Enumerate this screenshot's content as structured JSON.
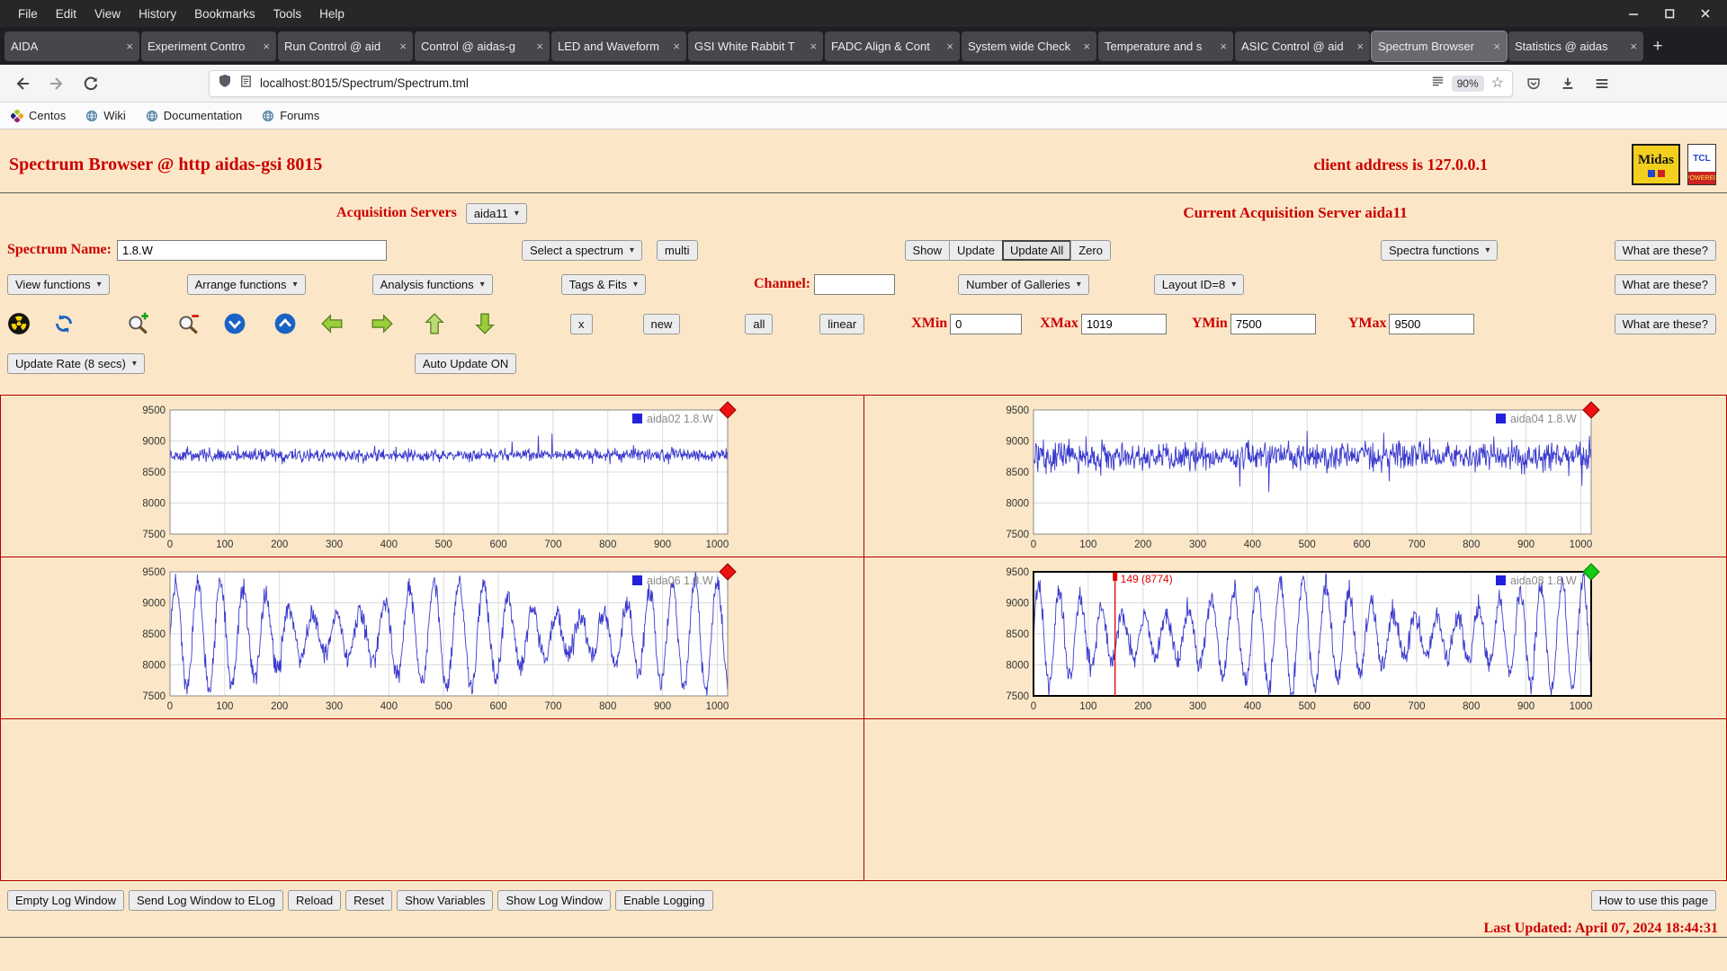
{
  "theme": {
    "accent_red": "#cc0000",
    "page_bg": "#fbe7c7",
    "gallery_border": "#b00000",
    "chart_line": "#3a3ace"
  },
  "browser": {
    "menubar": [
      "File",
      "Edit",
      "View",
      "History",
      "Bookmarks",
      "Tools",
      "Help"
    ],
    "tabs": [
      {
        "label": "AIDA",
        "active": false
      },
      {
        "label": "Experiment Contro",
        "active": false
      },
      {
        "label": "Run Control @ aid",
        "active": false
      },
      {
        "label": "Control @ aidas-g",
        "active": false
      },
      {
        "label": "LED and Waveform",
        "active": false
      },
      {
        "label": "GSI White Rabbit T",
        "active": false
      },
      {
        "label": "FADC Align & Cont",
        "active": false
      },
      {
        "label": "System wide Check",
        "active": false
      },
      {
        "label": "Temperature and s",
        "active": false
      },
      {
        "label": "ASIC Control @ aid",
        "active": false
      },
      {
        "label": "Spectrum Browser",
        "active": true
      },
      {
        "label": "Statistics @ aidas",
        "active": false
      }
    ],
    "new_tab_button": "+",
    "close_tab_glyph": "×",
    "urlbar": {
      "url": "localhost:8015/Spectrum/Spectrum.tml",
      "zoom": "90%",
      "star": "☆"
    },
    "bookmarks": [
      {
        "label": "Centos"
      },
      {
        "label": "Wiki"
      },
      {
        "label": "Documentation"
      },
      {
        "label": "Forums"
      }
    ]
  },
  "page": {
    "title": "Spectrum Browser @ http aidas-gsi 8015",
    "client_address": "client address is 127.0.0.1",
    "midas_logo": "Midas",
    "tcl_logo_top": "TCL",
    "tcl_logo_bottom": "POWERED",
    "acquisition_servers_label": "Acquisition Servers",
    "acquisition_server_select": "aida11",
    "current_server": "Current Acquisition Server aida11",
    "spectrum_name_label": "Spectrum Name:",
    "spectrum_name_value": "1.8.W",
    "select_spectrum": "Select a spectrum",
    "multi_button": "multi",
    "show_button": "Show",
    "update_button": "Update",
    "update_all_button": "Update All",
    "zero_button": "Zero",
    "spectra_functions": "Spectra functions",
    "what_are_these": "What are these?",
    "view_functions": "View functions",
    "arrange_functions": "Arrange functions",
    "analysis_functions": "Analysis functions",
    "tags_fits": "Tags & Fits",
    "channel_label": "Channel:",
    "channel_value": "",
    "number_of_galleries": "Number of Galleries",
    "layout_id": "Layout ID=8",
    "x_button": "x",
    "new_button": "new",
    "all_button": "all",
    "linear_button": "linear",
    "xmin_label": "XMin",
    "xmin": "0",
    "xmax_label": "XMax",
    "xmax": "1019",
    "ymin_label": "YMin",
    "ymin": "7500",
    "ymax_label": "YMax",
    "ymax": "9500",
    "update_rate": "Update Rate (8 secs)",
    "auto_update": "Auto Update ON",
    "log_buttons": [
      "Empty Log Window",
      "Send Log Window to ELog",
      "Reload",
      "Reset",
      "Show Variables",
      "Show Log Window",
      "Enable Logging"
    ],
    "help_button": "How to use this page",
    "last_updated": "Last Updated: April 07, 2024 18:44:31"
  },
  "gallery": {
    "rows": 3,
    "cols": 2,
    "populated_cells": 4
  },
  "chart_data": [
    {
      "type": "line",
      "name": "aida02",
      "legend": "aida02 1.8.W",
      "line_color": "#3a3ace",
      "legend_color": "#8a8a8a",
      "marker": "red-diamond",
      "marker_color": "#ee1111",
      "marker_stroke": "#8a0000",
      "selected": false,
      "xlim": [
        0,
        1019
      ],
      "ylim": [
        7500,
        9500
      ],
      "xticks": [
        0,
        100,
        200,
        300,
        400,
        500,
        600,
        700,
        800,
        900,
        1000
      ],
      "yticks": [
        7500,
        8000,
        8500,
        9000,
        9500
      ],
      "gen": {
        "kind": "noise",
        "seed": 12,
        "base": 8775,
        "sigma": 50,
        "spike_prob": 0.012,
        "spike_amp": 330,
        "dip_prob": 0.01,
        "dip_amp": 220
      }
    },
    {
      "type": "line",
      "name": "aida04",
      "legend": "aida04 1.8.W",
      "line_color": "#3a3ace",
      "legend_color": "#8a8a8a",
      "marker": "red-diamond",
      "marker_color": "#ee1111",
      "marker_stroke": "#8a0000",
      "selected": false,
      "xlim": [
        0,
        1019
      ],
      "ylim": [
        7500,
        9500
      ],
      "xticks": [
        0,
        100,
        200,
        300,
        400,
        500,
        600,
        700,
        800,
        900,
        1000
      ],
      "yticks": [
        7500,
        8000,
        8500,
        9000,
        9500
      ],
      "gen": {
        "kind": "noise",
        "seed": 34,
        "base": 8750,
        "sigma": 110,
        "spike_prob": 0.02,
        "spike_amp": 380,
        "dip_prob": 0.015,
        "dip_amp": 320
      }
    },
    {
      "type": "line",
      "name": "aida06",
      "legend": "aida06 1.8.W",
      "line_color": "#3a3ace",
      "legend_color": "#8a8a8a",
      "marker": "red-diamond",
      "marker_color": "#ee1111",
      "marker_stroke": "#8a0000",
      "selected": false,
      "xlim": [
        0,
        1019
      ],
      "ylim": [
        7500,
        9500
      ],
      "xticks": [
        0,
        100,
        200,
        300,
        400,
        500,
        600,
        700,
        800,
        900,
        1000
      ],
      "yticks": [
        7500,
        8000,
        8500,
        9000,
        9500
      ],
      "gen": {
        "kind": "osc",
        "seed": 56,
        "center": 8480,
        "amp": 880,
        "period": 43,
        "noise": 85,
        "mod1": 71,
        "mod2": 160,
        "mph": 0.6
      }
    },
    {
      "type": "line",
      "name": "aida08",
      "legend": "aida08 1.8.W",
      "line_color": "#3a3ace",
      "legend_color": "#333333",
      "marker": "green-diamond",
      "marker_color": "#11cc11",
      "marker_stroke": "#0a7a0a",
      "selected": true,
      "cursor": {
        "x": 149,
        "label": "149 (8774)"
      },
      "xlim": [
        0,
        1019
      ],
      "ylim": [
        7500,
        9500
      ],
      "xticks": [
        0,
        100,
        200,
        300,
        400,
        500,
        600,
        700,
        800,
        900,
        1000
      ],
      "yticks": [
        7500,
        8000,
        8500,
        9000,
        9500
      ],
      "gen": {
        "kind": "osc",
        "seed": 78,
        "center": 8470,
        "amp": 900,
        "period": 40,
        "noise": 85,
        "mod1": 83,
        "mod2": 140,
        "mph": 2.2
      }
    }
  ]
}
